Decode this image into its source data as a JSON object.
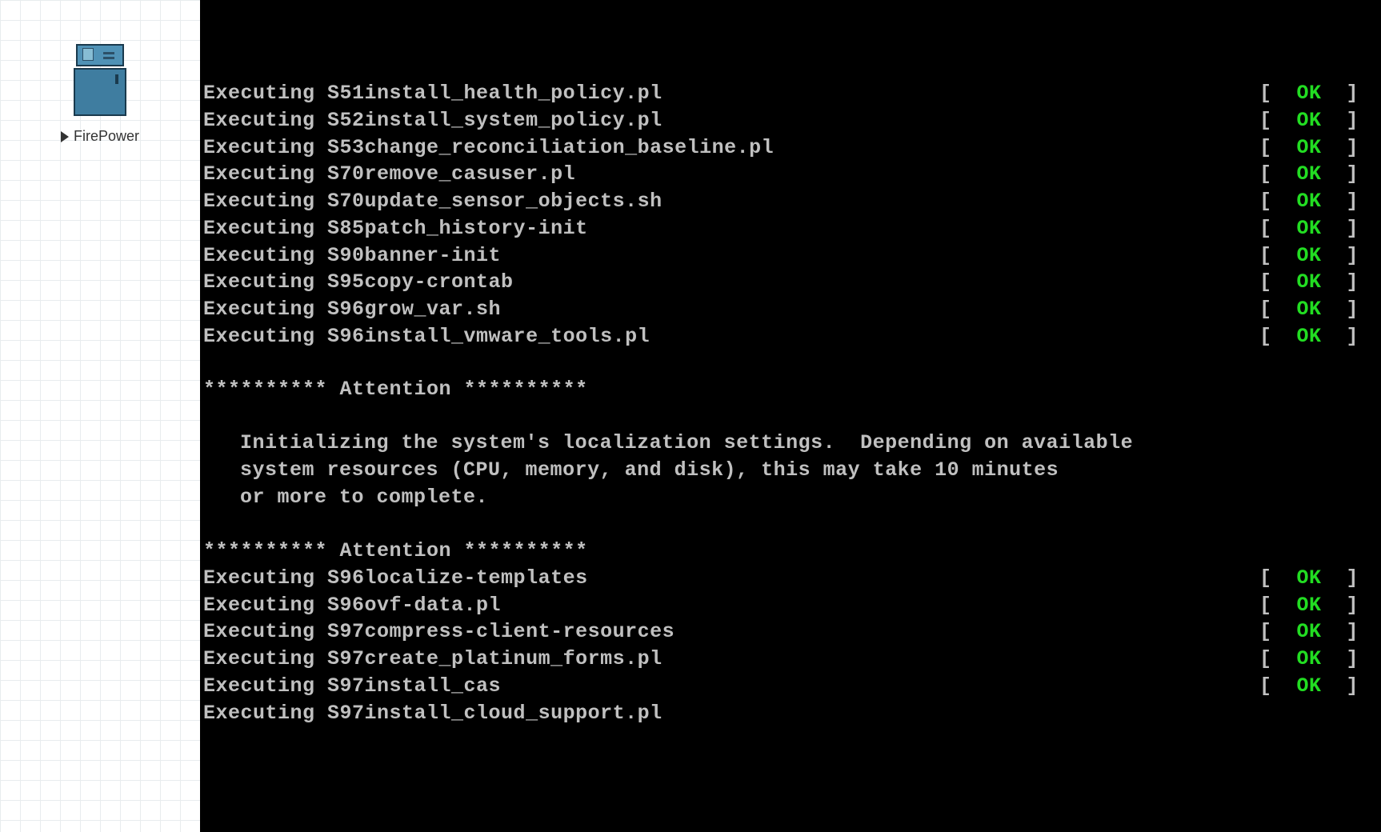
{
  "sidebar": {
    "item_label": "FirePower"
  },
  "console": {
    "prefix": "Executing ",
    "bracket_open": "[  ",
    "bracket_close": "  ]",
    "status_ok": "OK",
    "exec_lines_top": [
      "S51install_health_policy.pl",
      "S52install_system_policy.pl",
      "S53change_reconciliation_baseline.pl",
      "S70remove_casuser.pl",
      "S70update_sensor_objects.sh",
      "S85patch_history-init",
      "S90banner-init",
      "S95copy-crontab",
      "S96grow_var.sh",
      "S96install_vmware_tools.pl"
    ],
    "attention_header": "********** Attention **********",
    "attention_body_1": "Initializing the system's localization settings.  Depending on available",
    "attention_body_2": "system resources (CPU, memory, and disk), this may take 10 minutes",
    "attention_body_3": "or more to complete.",
    "exec_lines_mid": [
      "S96localize-templates",
      "S96ovf-data.pl",
      "S97compress-client-resources",
      "S97create_platinum_forms.pl",
      "S97install_cas"
    ],
    "exec_line_running": "S97install_cloud_support.pl"
  }
}
